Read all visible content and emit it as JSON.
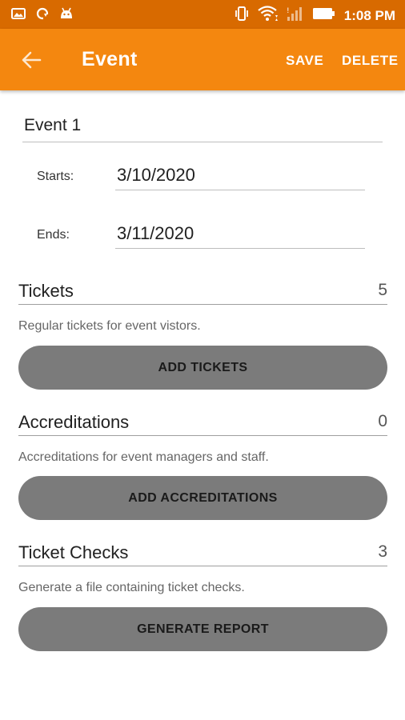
{
  "status_bar": {
    "time": "1:08 PM",
    "icons_left": [
      "photo-icon",
      "sync-icon",
      "android-icon"
    ],
    "icons_right": [
      "vibrate-icon",
      "wifi-icon",
      "signal-icon",
      "battery-icon"
    ]
  },
  "app_bar": {
    "title": "Event",
    "save_label": "SAVE",
    "delete_label": "DELETE",
    "color": "#f4870f"
  },
  "form": {
    "event_name": "Event 1",
    "starts_label": "Starts:",
    "starts_value": "3/10/2020",
    "ends_label": "Ends:",
    "ends_value": "3/11/2020"
  },
  "sections": [
    {
      "title": "Tickets",
      "count": "5",
      "description": "Regular tickets for event vistors.",
      "button_label": "ADD TICKETS"
    },
    {
      "title": "Accreditations",
      "count": "0",
      "description": "Accreditations for event managers and staff.",
      "button_label": "ADD ACCREDITATIONS"
    },
    {
      "title": "Ticket Checks",
      "count": "3",
      "description": "Generate a file containing ticket checks.",
      "button_label": "GENERATE REPORT"
    }
  ]
}
